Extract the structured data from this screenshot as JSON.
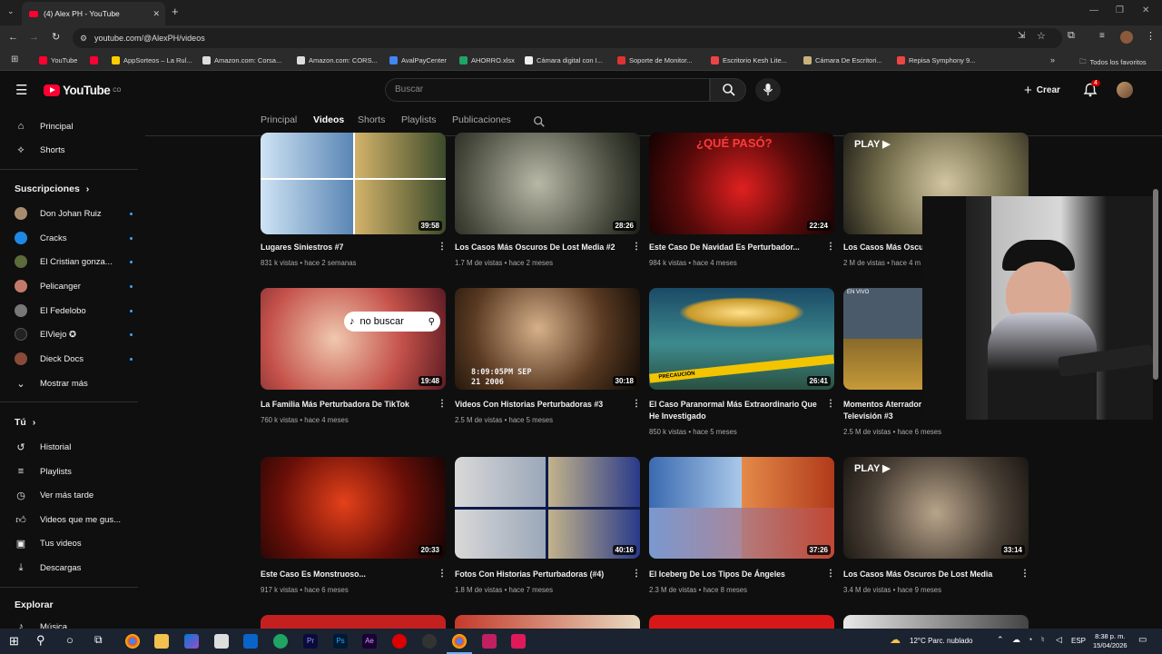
{
  "browser": {
    "tab_title": "(4) Alex PH - YouTube",
    "url": "youtube.com/@AlexPH/videos",
    "bookmarks": [
      "YouTube",
      "AppSorteos – La Rul...",
      "Amazon.com: Corsa...",
      "Amazon.com: CORS...",
      "AvalPayCenter",
      "AHORRO.xlsx",
      "Cámara digital con I...",
      "Soporte de Monitor...",
      "Escritorio Kesh Lite...",
      "Cámara De Escritori...",
      "Repisa Symphony 9..."
    ],
    "all_favorites": "Todos los favoritos"
  },
  "header": {
    "logo": "YouTube",
    "logo_sup": "CO",
    "search_placeholder": "Buscar",
    "create_label": "Crear",
    "notif_count": "4"
  },
  "sidebar": {
    "principal": "Principal",
    "shorts": "Shorts",
    "subscriptions_title": "Suscripciones",
    "subscriptions": [
      "Don Johan Ruiz",
      "Cracks",
      "El Cristian gonza...",
      "Pelicanger",
      "El Fedelobo",
      "ElViejo",
      "Dieck Docs"
    ],
    "show_more": "Mostrar más",
    "you_title": "Tú",
    "you_items": [
      "Historial",
      "Playlists",
      "Ver más tarde",
      "Videos que me gus...",
      "Tus videos",
      "Descargas"
    ],
    "explore_title": "Explorar",
    "explore_items": [
      "Música"
    ]
  },
  "channel_tabs": [
    "Principal",
    "Videos",
    "Shorts",
    "Playlists",
    "Publicaciones"
  ],
  "videos": [
    {
      "title": "Lugares Siniestros #7",
      "meta": "831 k vistas • hace 2 semanas",
      "duration": "39:58"
    },
    {
      "title": "Los Casos Más Oscuros De Lost Media #2",
      "meta": "1.7 M de vistas • hace 2 meses",
      "duration": "28:26"
    },
    {
      "title": "Este Caso De Navidad Es Perturbador...",
      "meta": "984 k vistas • hace 4 meses",
      "duration": "22:24",
      "overlay": "¿QUÉ PASÓ?"
    },
    {
      "title": "Los Casos Más Oscu",
      "meta": "2 M de vistas • hace 4 m",
      "duration": "",
      "overlay": "PLAY ▶"
    },
    {
      "title": "La Familia Más Perturbadora De TikTok",
      "meta": "760 k vistas • hace 4 meses",
      "duration": "19:48",
      "overlay": "no buscar"
    },
    {
      "title": "Videos Con Historias Perturbadoras #3",
      "meta": "2.5 M de vistas • hace 5 meses",
      "duration": "30:18",
      "overlay": "8:09:05PM SEP 21 2006"
    },
    {
      "title": "El Caso Paranormal Más Extraordinario Que He Investigado",
      "meta": "850 k vistas • hace 5 meses",
      "duration": "26:41",
      "overlay": "PRECAUCIÓN"
    },
    {
      "title": "Momentos Aterrador Televisión #3",
      "meta": "2.5 M de vistas • hace 6 meses",
      "duration": "",
      "overlay": "EN VIVO"
    },
    {
      "title": "Este Caso Es Monstruoso...",
      "meta": "917 k vistas • hace 6 meses",
      "duration": "20:33"
    },
    {
      "title": "Fotos Con Historias Perturbadoras (#4)",
      "meta": "1.8 M de vistas • hace 7 meses",
      "duration": "40:16"
    },
    {
      "title": "El Iceberg De Los Tipos De Ángeles",
      "meta": "2.3 M de vistas • hace 8 meses",
      "duration": "37:26"
    },
    {
      "title": "Los Casos Más Oscuros De Lost Media",
      "meta": "3.4 M de vistas • hace 9 meses",
      "duration": "33:14",
      "overlay": "PLAY ▶"
    }
  ],
  "taskbar": {
    "weather": "12°C  Parc. nublado",
    "lang": "ESP",
    "time": "8:38 p. m.",
    "date": "15/04/2026"
  }
}
